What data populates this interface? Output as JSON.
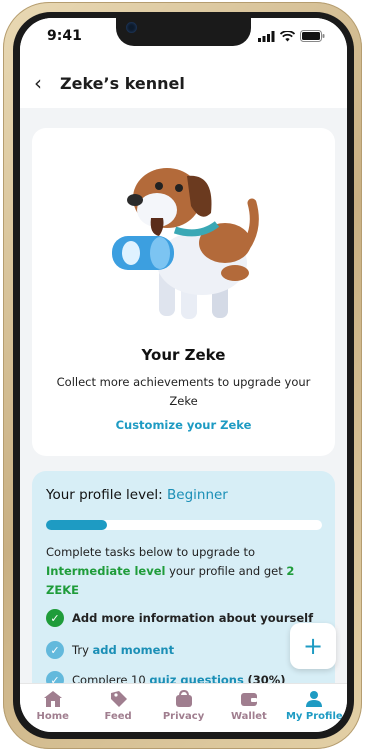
{
  "status_bar": {
    "time": "9:41"
  },
  "header": {
    "title": "Zeke’s kennel"
  },
  "zeke_card": {
    "title": "Your Zeke",
    "description": "Collect more achievements to upgrade your Zeke",
    "customize_link": "Customize your Zeke"
  },
  "profile": {
    "level_label": "Your profile level:",
    "level_value": "Beginner",
    "progress": 0.22,
    "upgrade_text_1": "Complete tasks below to upgrade to",
    "upgrade_level": "Intermediate level",
    "upgrade_text_2": "your profile and get",
    "upgrade_reward": "2 ZEKE",
    "tasks": [
      {
        "text": "Add more information about yourself",
        "link": "",
        "suffix": "",
        "done": true
      },
      {
        "text": "Try",
        "link": "add moment",
        "suffix": "",
        "done": false
      },
      {
        "text": "Complere 10",
        "link": "quiz questions",
        "suffix": "(30%)",
        "done": false
      }
    ]
  },
  "fab": {
    "icon": "plus-icon",
    "label": "+"
  },
  "bottom_nav": {
    "items": [
      {
        "label": "Home",
        "icon": "home-icon"
      },
      {
        "label": "Feed",
        "icon": "feed-tag-icon"
      },
      {
        "label": "Privacy",
        "icon": "privacy-bag-icon"
      },
      {
        "label": "Wallet",
        "icon": "wallet-icon"
      },
      {
        "label": "My Profile",
        "icon": "profile-icon"
      }
    ],
    "active_index": 4
  },
  "colors": {
    "accent": "#1e9bc3",
    "success": "#1f9c3a",
    "nav_inactive": "#a07e8f",
    "card_tint": "#d7eef6"
  }
}
